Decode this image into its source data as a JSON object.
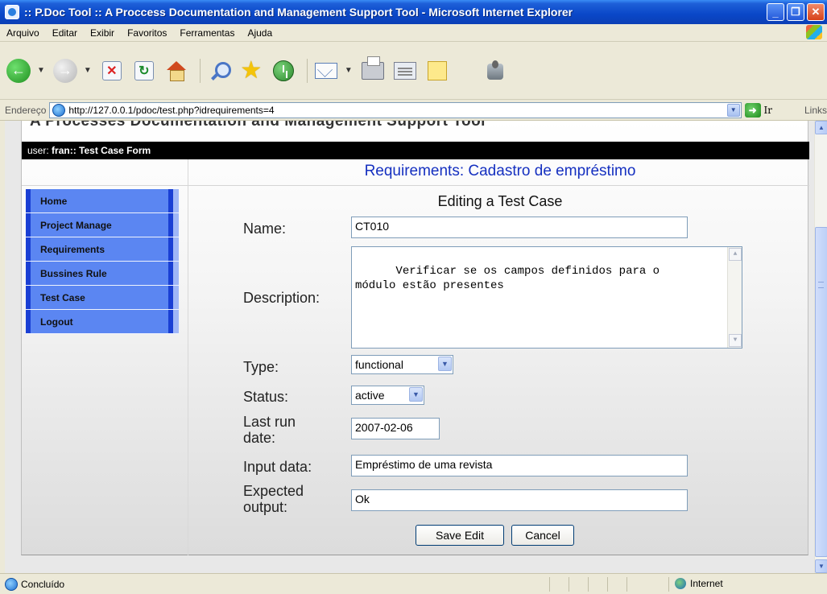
{
  "window": {
    "title": ":: P.Doc Tool :: A Proccess Documentation and Management Support Tool - Microsoft Internet Explorer"
  },
  "menu": [
    "Arquivo",
    "Editar",
    "Exibir",
    "Favoritos",
    "Ferramentas",
    "Ajuda"
  ],
  "address": {
    "label": "Endereço",
    "url": "http://127.0.0.1/pdoc/test.php?idrequirements=4",
    "go_label": "Ir",
    "links_label": "Links"
  },
  "page": {
    "site_header": "A Processes Documentation and Management Support Tool",
    "user_prefix": "user: ",
    "user_name": "fran",
    "user_section": " :: Test Case Form",
    "requirement_title": "Requirements: Cadastro de empréstimo",
    "nav": [
      "Home",
      "Project Manage",
      "Requirements",
      "Bussines Rule",
      "Test Case",
      "Logout"
    ],
    "form": {
      "heading": "Editing a Test Case",
      "name_label": "Name:",
      "name_value": "CT010",
      "description_label": "Description:",
      "description_value": "Verificar se os campos definidos para o\nmódulo estão presentes",
      "type_label": "Type:",
      "type_value": "functional",
      "status_label": "Status:",
      "status_value": "active",
      "last_run_label": "Last run date:",
      "last_run_value": "2007-02-06",
      "input_data_label": "Input data:",
      "input_data_value": "Empréstimo de uma revista",
      "expected_output_label": "Expected output:",
      "expected_output_value": "Ok",
      "save_label": "Save Edit",
      "cancel_label": "Cancel"
    }
  },
  "status": {
    "text": "Concluído",
    "zone": "Internet"
  },
  "colors": {
    "titlebar": "#0a47c8",
    "nav_blue": "#5b86f2",
    "requirement_title": "#1530c0"
  }
}
